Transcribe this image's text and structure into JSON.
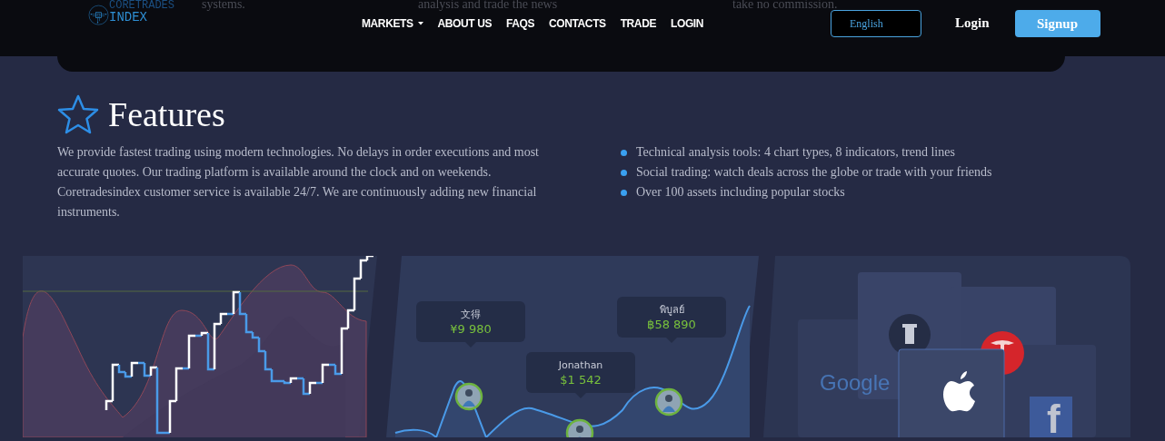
{
  "background_text": [
    "systems.",
    "analysis and trade the news",
    "take no commission."
  ],
  "logo": {
    "line_1": "CORETRADES",
    "line_2": "INDEX"
  },
  "nav": {
    "items": [
      {
        "label": "MARKETS",
        "dropdown": true
      },
      {
        "label": "ABOUT US",
        "dropdown": false
      },
      {
        "label": "FAQS",
        "dropdown": false
      },
      {
        "label": "CONTACTS",
        "dropdown": false
      },
      {
        "label": "TRADE",
        "dropdown": false
      },
      {
        "label": "LOGIN",
        "dropdown": false
      }
    ]
  },
  "language": {
    "value": "English"
  },
  "login": "Login",
  "signup": "Signup",
  "features": {
    "title": "Features",
    "description": "We provide fastest trading using modern technologies. No delays in order executions and most accurate quotes. Our trading platform is available around the clock and on weekends. Coretradesindex customer service is available 24/7. We are continuously adding new financial instruments.",
    "bullets": [
      "Technical analysis tools: 4 chart types, 8 indicators, trend lines",
      "Social trading: watch deals across the globe or trade with your friends",
      "Over 100 assets including popular stocks"
    ]
  },
  "social_panel": {
    "traders": [
      {
        "name": "文得",
        "amount": "¥9 980"
      },
      {
        "name": "Jonathan",
        "amount": "$1 542"
      },
      {
        "name": "พิบูลย์",
        "amount": "฿58 890"
      }
    ]
  },
  "assets_panel": {
    "wordmark": "Google",
    "tile_letter": "f"
  }
}
